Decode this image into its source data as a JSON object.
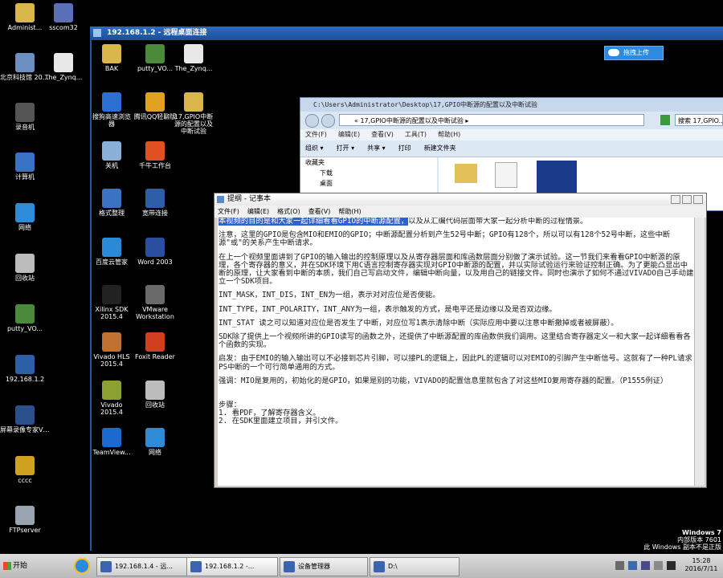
{
  "host_desktop": {
    "icons": [
      {
        "label": "Administ...",
        "color": "#d9b64a"
      },
      {
        "label": "sscom32",
        "color": "#5b6fb8"
      },
      {
        "label": "北京科技馆 2016-6-11",
        "color": "#6a8fc0"
      },
      {
        "label": "The_Zynq...",
        "color": "#e8e8e8"
      },
      {
        "label": "录音机",
        "color": "#555"
      },
      {
        "label": "计算机",
        "color": "#3a72c4"
      },
      {
        "label": "网络",
        "color": "#2d8bd8"
      },
      {
        "label": "回收站",
        "color": "#bcbcbc"
      },
      {
        "label": "putty_VO...",
        "color": "#4a8a3a"
      },
      {
        "label": "192.168.1.2",
        "color": "#2d5fa8"
      },
      {
        "label": "屏幕录像专家V7.5",
        "color": "#2b4f8a"
      },
      {
        "label": "cccc",
        "color": "#d0a020"
      },
      {
        "label": "FTPserver",
        "color": "#9aa4b0"
      }
    ],
    "watermark": {
      "line1": "Windows 7",
      "line2": "内部版本 7601",
      "line3": "此 Windows 副本不是正版"
    }
  },
  "remote_window": {
    "title": "192.168.1.2 - 远程桌面连接",
    "upload_button": "拖拽上传",
    "icons": [
      {
        "label": "BAK",
        "color": "#d9b64a"
      },
      {
        "label": "putty_VO...",
        "color": "#4a8a3a"
      },
      {
        "label": "The_Zynq...",
        "color": "#e8e8e8"
      },
      {
        "label": "搜狗高速浏览器",
        "color": "#2b6fd0"
      },
      {
        "label": "腾讯QQ轻聊版",
        "color": "#e0a020"
      },
      {
        "label": "17,GPIO中断源的配置以及中断试验",
        "color": "#d9b64a"
      },
      {
        "label": "关机",
        "color": "#8ab0d8"
      },
      {
        "label": "千牛工作台",
        "color": "#e05020"
      },
      {
        "label": "格式整理",
        "color": "#3a72c4"
      },
      {
        "label": "宽带连接",
        "color": "#2d5fa8"
      },
      {
        "label": "百度云管家",
        "color": "#2b8ad8"
      },
      {
        "label": "Word 2003",
        "color": "#2a4fa0"
      },
      {
        "label": "Xilinx SDK 2015.4",
        "color": "#222"
      },
      {
        "label": "VMware Workstation",
        "color": "#6a6a6a"
      },
      {
        "label": "Vivado HLS 2015.4",
        "color": "#c07030"
      },
      {
        "label": "Foxit Reader",
        "color": "#d04020"
      },
      {
        "label": "Vivado 2015.4",
        "color": "#8aa030"
      },
      {
        "label": "回收站",
        "color": "#bcbcbc"
      },
      {
        "label": "TeamView...",
        "color": "#1a6ad0"
      },
      {
        "label": "网络",
        "color": "#2d8bd8"
      }
    ]
  },
  "explorer": {
    "title": "C:\\Users\\Administrator\\Desktop\\17,GPIO中断源的配置以及中断试验",
    "address": "« 17,GPIO中断源的配置以及中断试验 ▸",
    "search_placeholder": "搜索 17,GPIO...",
    "menu": [
      "文件(F)",
      "编辑(E)",
      "查看(V)",
      "工具(T)",
      "帮助(H)"
    ],
    "toolbar": [
      "组织 ▾",
      "打开 ▾",
      "共享 ▾",
      "打印",
      "新建文件夹"
    ],
    "sidebar": [
      "收藏夹",
      "下载",
      "桌面"
    ]
  },
  "notepad": {
    "title": "提纲 - 记事本",
    "menu": [
      "文件(F)",
      "编辑(E)",
      "格式(O)",
      "查看(V)",
      "帮助(H)"
    ],
    "selected_text": "本视频的目的是和大家一起详细看看GPIO的中断源配置，",
    "first_line_rest": "以及从汇编代码层面带大家一起分析中断的过程情景。",
    "paragraphs": [
      "注意，这里的GPIO是包含MIO和EMIO的GPIO；中断源配置分析到产生52号中断；GPIO有128个，所以可以有128个52号中断，这些中断源\"或\"的关系产生中断请求。",
      "在上一个视频里面讲到了GPIO的输入输出的控制原理以及从寄存器层面和库函数层面分别做了演示试验。这一节我们来看看GPIO中断源的原理，各个寄存器的意义，并在SDK环境下用C语言控制寄存器实现对GPIO中断源的配置，并以实际试验运行来验证控制正确。为了更能凸显出中断的原理，让大家看到中断的本质，我们自己写启动文件，编辑中断向量，以及用自己的链接文件。同时也演示了如何不通过VIVADO自己手动建立一个SDK项目。",
      "INT_MASK，INT_DIS，INT_EN为一组，表示对对应位是否使能。",
      "INT_TYPE，INT_POLARITY，INT_ANY为一组，表示触发的方式，是电平还是边缘以及是否双边缘。",
      "INT_STAT 读之可以知道对应位是否发生了中断，对应位写1表示清除中断（实际应用中要以注意中断撤掉或者被屏蔽）。",
      "SDK除了提供上一个视频所讲的GPIO读写的函数之外，还提供了中断源配置的库函数供我们调用。这里结合寄存器定义一和大家一起详细看看各个函数的实现。",
      "启发：由于EMIO的输入输出可以不必接到芯片引脚，可以接PL的逻辑上，因此PL的逻辑可以对EMIO的引脚产生中断信号。这就有了一种PL请求PS中断的一个可行简单通用的方式。",
      "强调：MIO是复用的，初始化的是GPIO，如果是别的功能，VIVADO的配置信息里就包含了对这些MIO复用寄存器的配置。（P1555例证）",
      "",
      "步骤：\n1. 看PDF，了解寄存器含义。\n2. 在SDK里面建立项目，并引文件。"
    ]
  },
  "taskbar": {
    "start": "开始",
    "items": [
      "192.168.1.4 - 远...",
      "192.168.1.2 -...",
      "设备管理器",
      "D:\\"
    ],
    "time": "15:28",
    "date": "2016/7/11"
  }
}
